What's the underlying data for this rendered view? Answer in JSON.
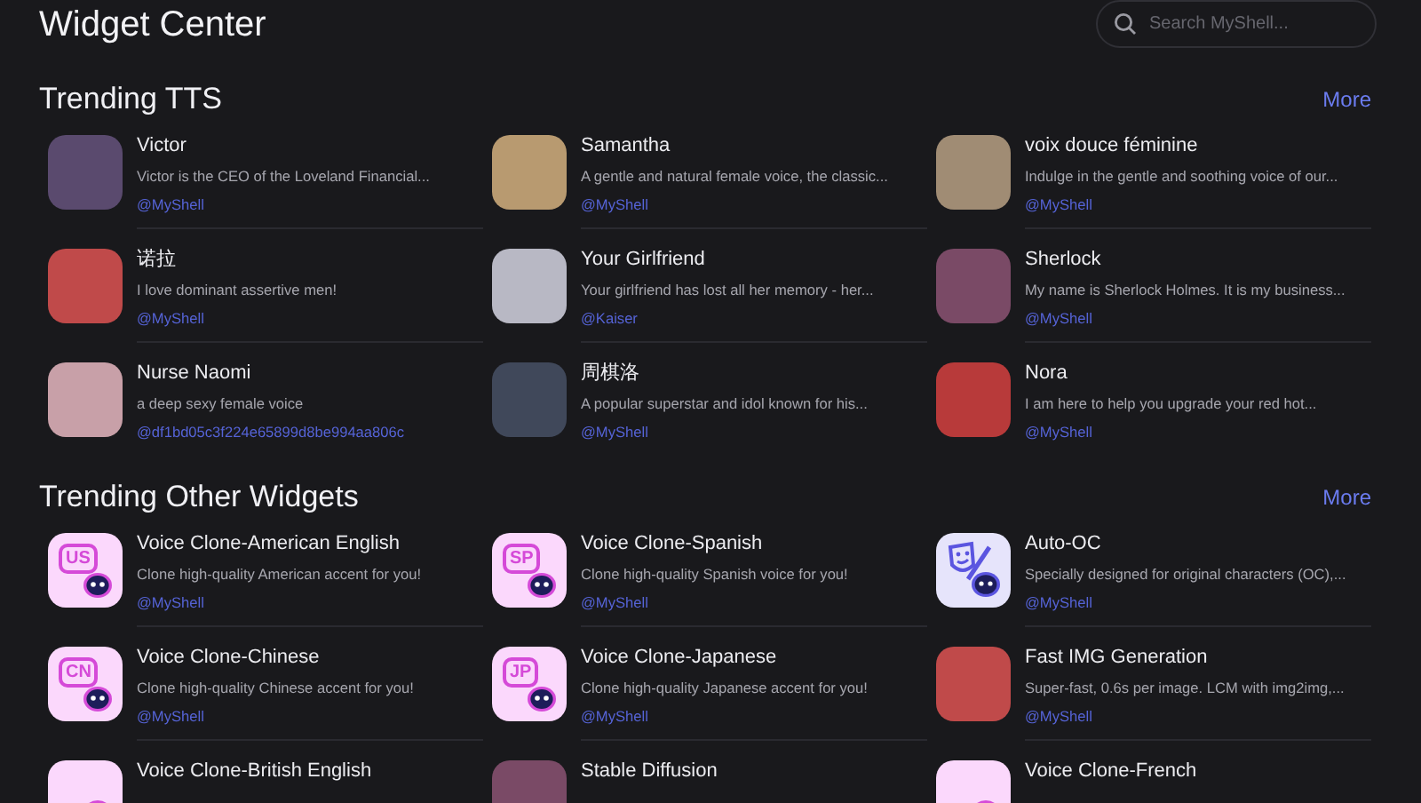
{
  "header": {
    "title": "Widget Center",
    "search": {
      "placeholder": "Search MyShell..."
    }
  },
  "sections": [
    {
      "title": "Trending TTS",
      "more": "More",
      "items": [
        {
          "kind": "photo",
          "name": "Victor",
          "description": "Victor is the CEO of the Loveland Financial...",
          "author": "@MyShell"
        },
        {
          "kind": "photo",
          "name": "Samantha",
          "description": "A gentle and natural female voice, the classic...",
          "author": "@MyShell"
        },
        {
          "kind": "photo",
          "name": "voix douce féminine",
          "description": "Indulge in the gentle and soothing voice of our...",
          "author": "@MyShell"
        },
        {
          "kind": "photo",
          "name": "诺拉",
          "description": "I love dominant assertive men!",
          "author": "@MyShell"
        },
        {
          "kind": "photo",
          "name": "Your Girlfriend",
          "description": "Your girlfriend has lost all her memory - her...",
          "author": "@Kaiser"
        },
        {
          "kind": "photo",
          "name": "Sherlock",
          "description": "My name is Sherlock Holmes. It is my business...",
          "author": "@MyShell"
        },
        {
          "kind": "photo",
          "name": "Nurse Naomi",
          "description": "a deep sexy female voice",
          "author": "@df1bd05c3f224e65899d8be994aa806c"
        },
        {
          "kind": "photo",
          "name": "周棋洛",
          "description": "A popular superstar and idol known for his...",
          "author": "@MyShell"
        },
        {
          "kind": "photo",
          "name": "Nora",
          "description": "I am here to help you upgrade your red hot...",
          "author": "@MyShell"
        }
      ]
    },
    {
      "title": "Trending Other Widgets",
      "more": "More",
      "items": [
        {
          "kind": "voice-clone",
          "badge": "US",
          "name": "Voice Clone-American English",
          "description": "Clone high-quality American accent for you!",
          "author": "@MyShell"
        },
        {
          "kind": "voice-clone",
          "badge": "SP",
          "name": "Voice Clone-Spanish",
          "description": "Clone high-quality Spanish voice for you!",
          "author": "@MyShell"
        },
        {
          "kind": "mask",
          "name": "Auto-OC",
          "description": "Specially designed for original characters (OC),...",
          "author": "@MyShell"
        },
        {
          "kind": "voice-clone",
          "badge": "CN",
          "name": "Voice Clone-Chinese",
          "description": "Clone high-quality Chinese accent for you!",
          "author": "@MyShell"
        },
        {
          "kind": "voice-clone",
          "badge": "JP",
          "name": "Voice Clone-Japanese",
          "description": "Clone high-quality Japanese accent for you!",
          "author": "@MyShell"
        },
        {
          "kind": "photo",
          "name": "Fast IMG Generation",
          "description": "Super-fast, 0.6s per image. LCM with img2img,...",
          "author": "@MyShell"
        },
        {
          "kind": "voice-clone",
          "name": "Voice Clone-British English"
        },
        {
          "kind": "photo",
          "name": "Stable Diffusion"
        },
        {
          "kind": "voice-clone",
          "name": "Voice Clone-French"
        }
      ]
    }
  ]
}
